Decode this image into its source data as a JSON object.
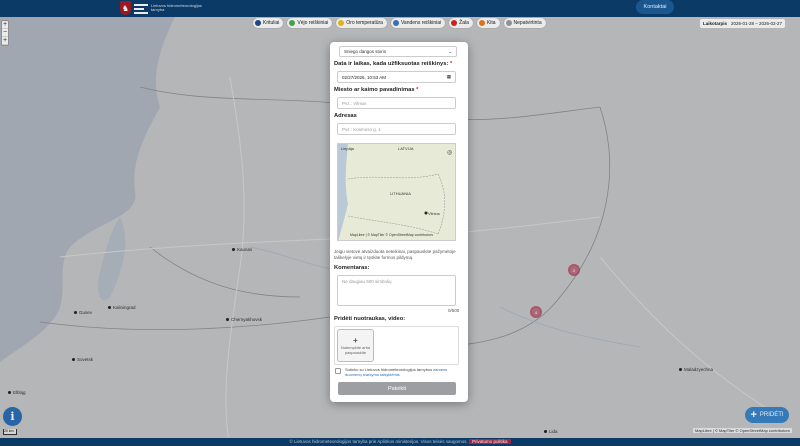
{
  "header": {
    "logo_text": "Lietuvos hidrometeorologijos tarnyba",
    "contacts_button": "Kontaktai"
  },
  "zoom": {
    "in": "+",
    "out": "−",
    "reset": "+"
  },
  "legend": [
    {
      "label": "Krituliai",
      "color": "#1f4e8c"
    },
    {
      "label": "Vėjo reiškiniai",
      "color": "#4caf50"
    },
    {
      "label": "Oro temperatūra",
      "color": "#f0c419"
    },
    {
      "label": "Vandens reiškiniai",
      "color": "#3b7bbf"
    },
    {
      "label": "Žala",
      "color": "#e02424"
    },
    {
      "label": "Kita",
      "color": "#f07c1c"
    },
    {
      "label": "Nepatvirtinta",
      "color": "#9e9e9e"
    }
  ],
  "date_filter": {
    "label": "Laikotarpis",
    "value": "2026-01-28 – 2026-02-27"
  },
  "map": {
    "cities": [
      {
        "name": "Kaunas"
      },
      {
        "name": "Kaliningrad"
      },
      {
        "name": "Gusev"
      },
      {
        "name": "Chernyakhovsk"
      },
      {
        "name": "Sovetsk"
      },
      {
        "name": "Elbląg"
      },
      {
        "name": "Maladzyechna"
      },
      {
        "name": "Lida"
      },
      {
        "name": "Vilnius"
      }
    ],
    "clusters": [
      "2",
      "4"
    ],
    "attribution": "MapLibre | © MapTiler © OpenStreetMap contributors",
    "scale": "20 km"
  },
  "form": {
    "event_type": "Sniego dangos storis",
    "datetime_label": "Data ir laikas, kada užfiksuotas reiškinys:",
    "datetime_value": "02/27/2026, 10:53 AM",
    "city_label": "Miesto ar kaimo pavadinimas",
    "city_placeholder": "Pvz.: Vilnius",
    "address_label": "Adresas",
    "address_placeholder": "Pvz.: Kosmoso g. 1",
    "minimap": {
      "labels": [
        "Liepāja",
        "LATVIJA",
        "LITHUANIA",
        "Vilnius"
      ],
      "attribution": "MapLibre | © MapTiler © OpenStreetMap contributors"
    },
    "help_text": "Jeigu vietovė atvaizduota neteikinai, paspauskite pažymėtoje taškelyje vietą ir tęskite formos pildymą.",
    "comments_label": "Komentaras:",
    "comments_placeholder": "Ne daugiau 500 simbolių",
    "counter": "0/500",
    "upload_label": "Pridėti nuotraukas, video:",
    "upload_button": "Nutempkite arba paspauskite",
    "consent_prefix": "Sutinku su Lietuvos hidrometeorologijos tarnybos",
    "consent_link": "asmens duomenų tvarkymo taisyklėmis",
    "submit": "Pateikti"
  },
  "buttons": {
    "info": "i",
    "add": "PRIDĖTI"
  },
  "footer": {
    "text": "© Lietuvos hidrometeorologijos tarnyba prie Aplinkos ministerijos. Visos teisės saugomos.",
    "highlight": "Privatumo politika"
  }
}
